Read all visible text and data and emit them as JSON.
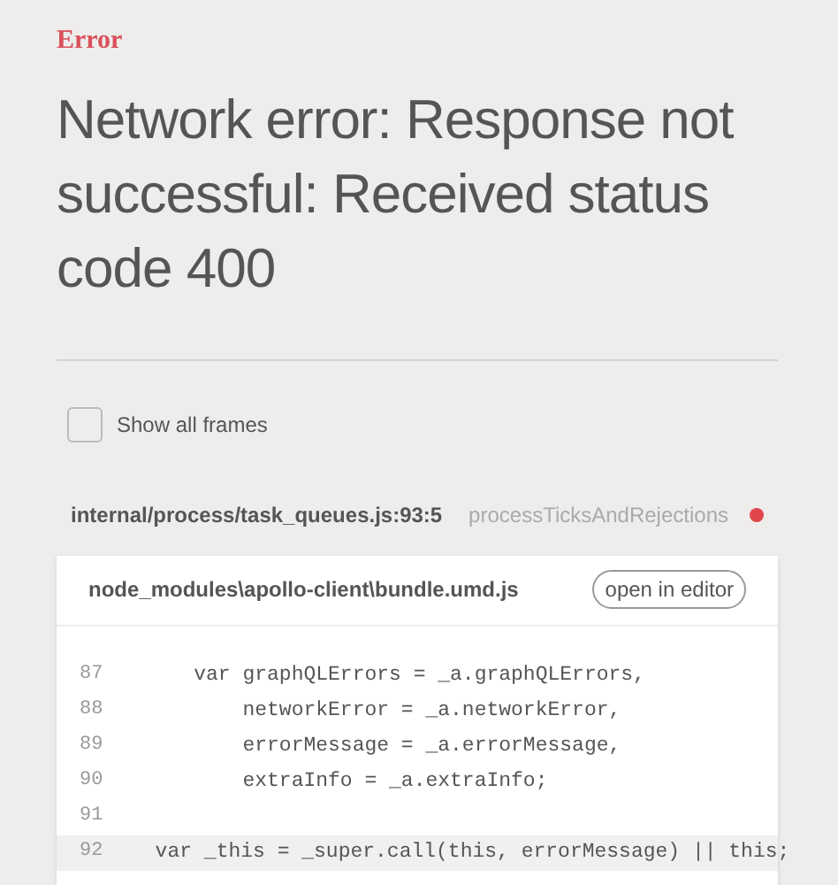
{
  "label": "Error",
  "title": "Network error: Response not successful: Received status code 400",
  "show_all_frames": {
    "label": "Show all frames",
    "checked": false
  },
  "frame": {
    "location": "internal/process/task_queues.js:93:5",
    "function": "processTicksAndRejections",
    "color": "#e0474c"
  },
  "source": {
    "file": "node_modules\\apollo-client\\bundle.umd.js",
    "button": "open in editor",
    "lines": [
      {
        "number": "87",
        "code": "    var graphQLErrors = _a.graphQLErrors,",
        "highlighted": false
      },
      {
        "number": "88",
        "code": "        networkError = _a.networkError,",
        "highlighted": false
      },
      {
        "number": "89",
        "code": "        errorMessage = _a.errorMessage,",
        "highlighted": false
      },
      {
        "number": "90",
        "code": "        extraInfo = _a.extraInfo;",
        "highlighted": false
      },
      {
        "number": "91",
        "highlighted": false
      },
      {
        "number": "92",
        "code": "    var _this = _super.call(this, errorMessage) || this;",
        "highlighted": true
      }
    ]
  }
}
